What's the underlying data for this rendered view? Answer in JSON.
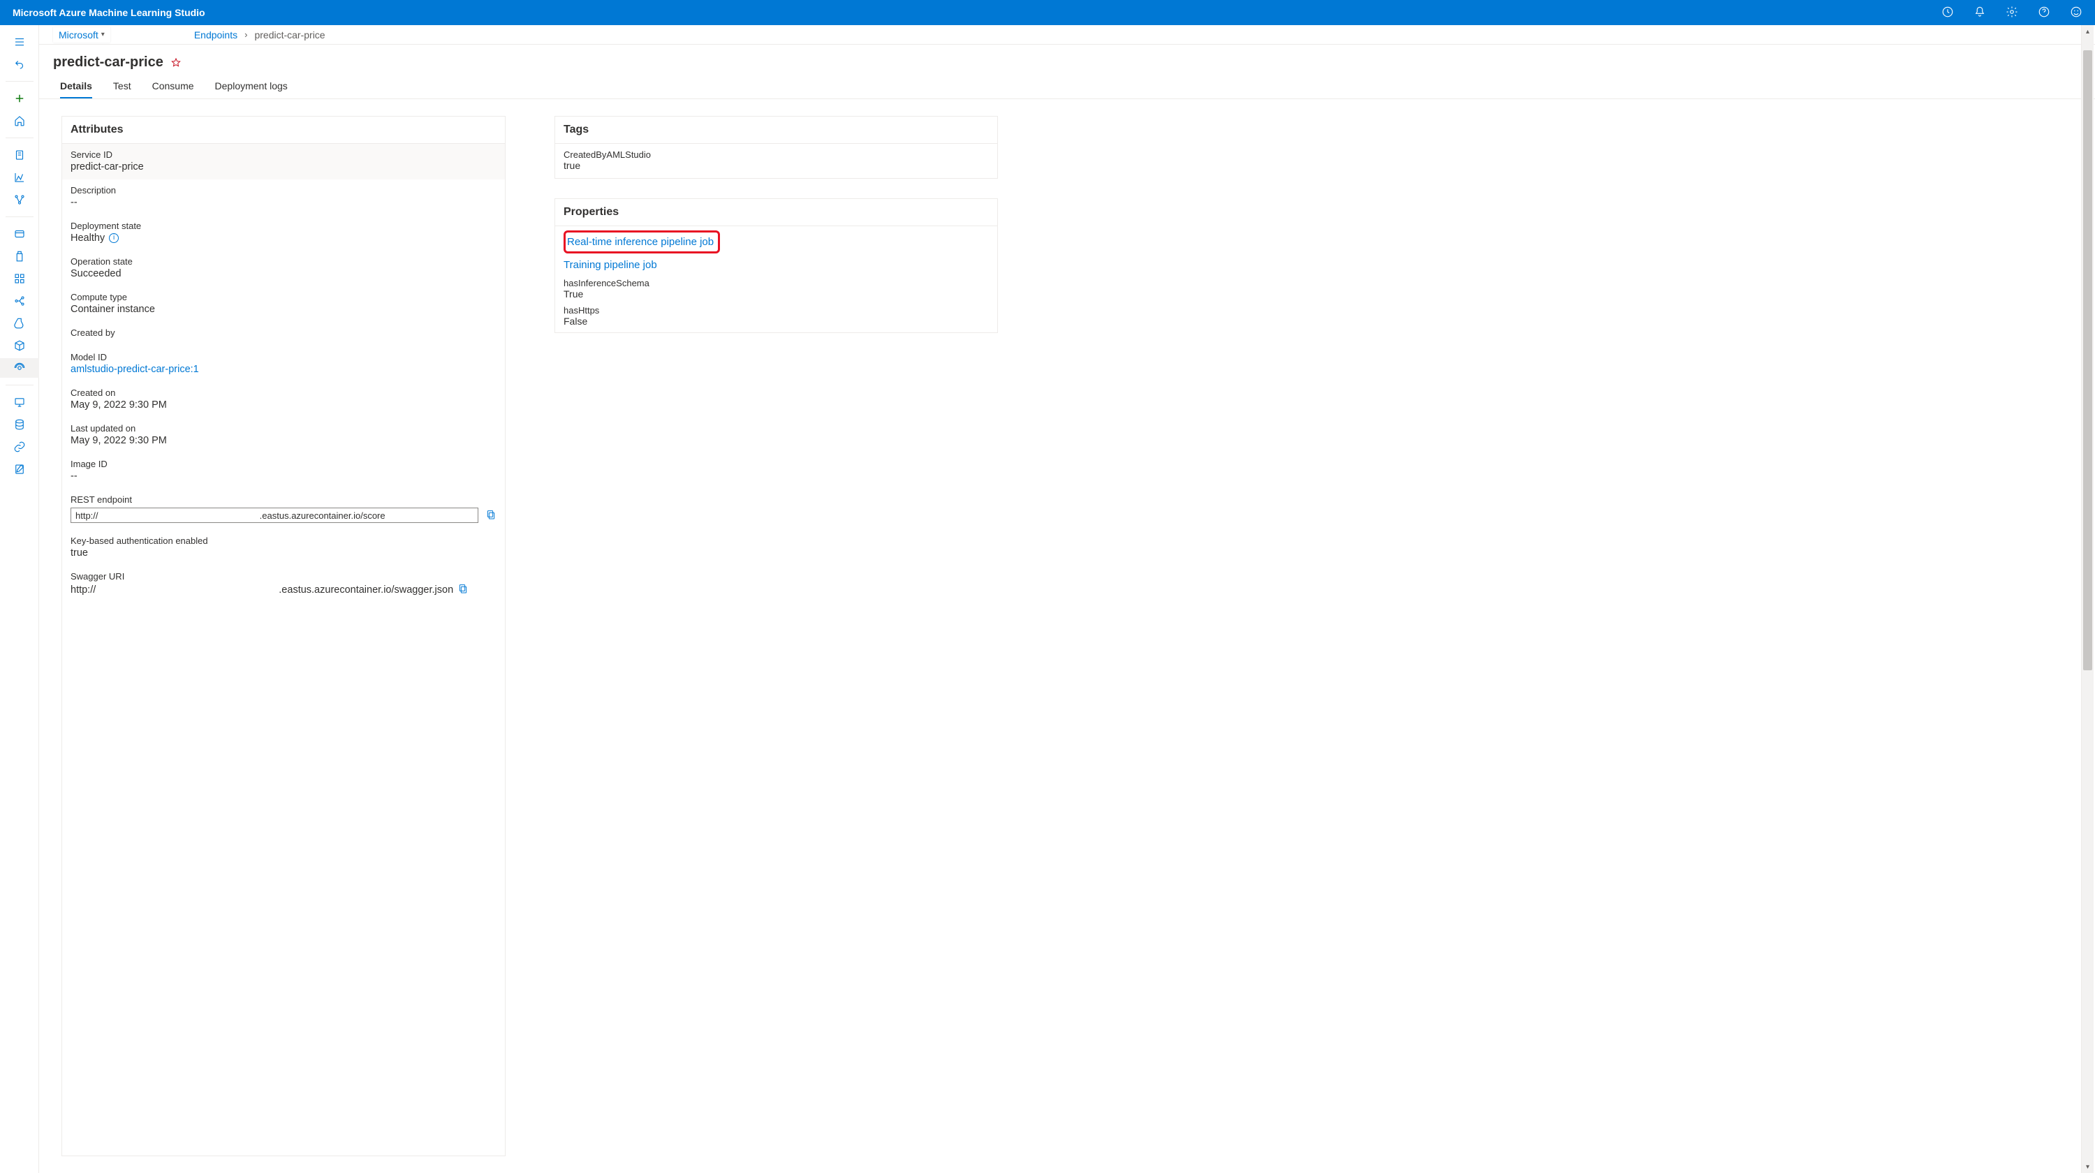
{
  "topbar": {
    "title": "Microsoft Azure Machine Learning Studio"
  },
  "breadcrumb": {
    "workspace": "Microsoft",
    "endpoints": "Endpoints",
    "current": "predict-car-price"
  },
  "title": "predict-car-price",
  "tabs": {
    "details": "Details",
    "test": "Test",
    "consume": "Consume",
    "logs": "Deployment logs"
  },
  "attributes": {
    "header": "Attributes",
    "service_id_label": "Service ID",
    "service_id": "predict-car-price",
    "description_label": "Description",
    "description": "--",
    "deploy_state_label": "Deployment state",
    "deploy_state": "Healthy",
    "operation_state_label": "Operation state",
    "operation_state": "Succeeded",
    "compute_type_label": "Compute type",
    "compute_type": "Container instance",
    "created_by_label": "Created by",
    "created_by": "",
    "model_id_label": "Model ID",
    "model_id": "amlstudio-predict-car-price:1",
    "created_on_label": "Created on",
    "created_on": "May 9, 2022 9:30 PM",
    "updated_on_label": "Last updated on",
    "updated_on": "May 9, 2022 9:30 PM",
    "image_id_label": "Image ID",
    "image_id": "--",
    "rest_label": "REST endpoint",
    "rest_value": "http://                                                                .eastus.azurecontainer.io/score",
    "key_auth_label": "Key-based authentication enabled",
    "key_auth": "true",
    "swagger_label": "Swagger URI",
    "swagger_uri_pre": "http://",
    "swagger_uri_post": ".eastus.azurecontainer.io/swagger.json"
  },
  "tags": {
    "header": "Tags",
    "created_label": "CreatedByAMLStudio",
    "created_value": "true"
  },
  "properties": {
    "header": "Properties",
    "realtime_link": "Real-time inference pipeline job",
    "training_link": "Training pipeline job",
    "has_schema_label": "hasInferenceSchema",
    "has_schema_value": "True",
    "has_https_label": "hasHttps",
    "has_https_value": "False"
  }
}
